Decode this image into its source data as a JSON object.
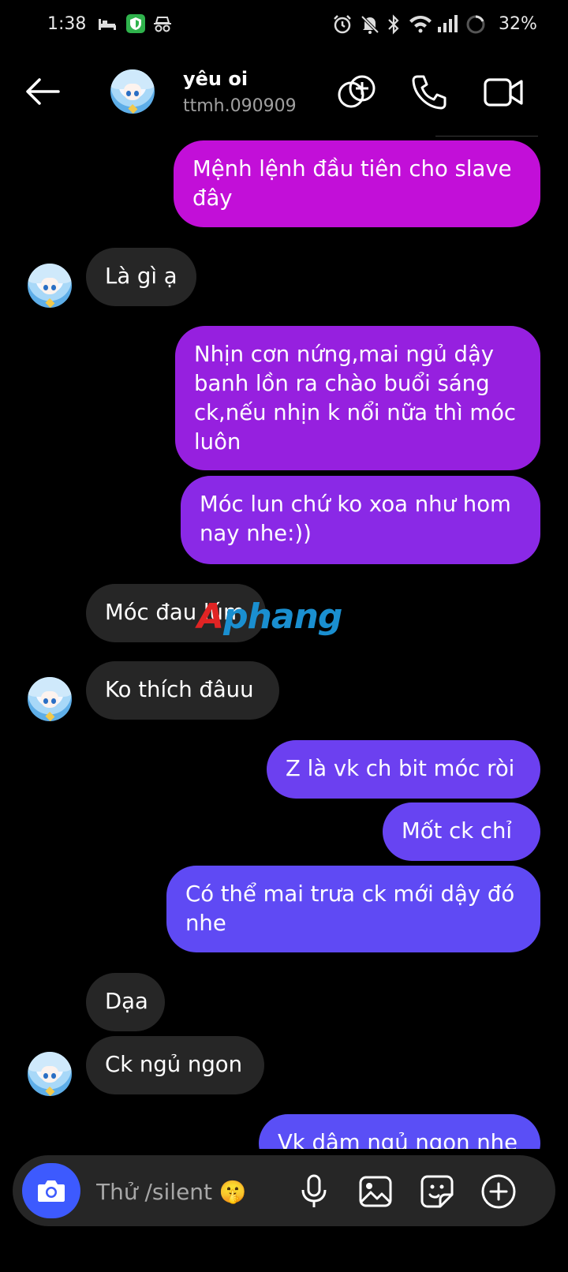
{
  "status_bar": {
    "time": "1:38",
    "battery": "32%",
    "icons": [
      "sleep-icon",
      "shield-app-icon",
      "incognito-icon",
      "alarm-icon",
      "bell-off-icon",
      "bluetooth-icon",
      "wifi-icon",
      "signal-icon",
      "battery-icon"
    ]
  },
  "header": {
    "contact_name": "yêu oi",
    "username": "ttmh.090909",
    "actions": [
      "add-effects-icon",
      "phone-icon",
      "video-camera-icon"
    ]
  },
  "messages": [
    {
      "side": "out",
      "text": "Mệnh lệnh đầu tiên cho slave đây",
      "color": "#c20fd8"
    },
    {
      "side": "in",
      "text": "Là gì ạ"
    },
    {
      "side": "out",
      "text": "Nhịn cơn nứng,mai ngủ dậy banh lồn ra chào buổi sáng ck,nếu nhịn k nổi nữa thì móc luôn",
      "color": "#9620df"
    },
    {
      "side": "out",
      "text": "Móc lun chứ ko xoa như hom nay nhe:))",
      "color": "#8a29e6"
    },
    {
      "side": "in",
      "text": "Móc đau lúm"
    },
    {
      "side": "in",
      "text": "Ko thích đâuu"
    },
    {
      "side": "out",
      "text": "Z là vk ch bit móc ròi",
      "color": "#6c40f0"
    },
    {
      "side": "out",
      "text": "Mốt ck chỉ",
      "color": "#6744f2"
    },
    {
      "side": "out",
      "text": "Có thể mai trưa ck mới dậy đó nhe",
      "color": "#5f4af4"
    },
    {
      "side": "in",
      "text": "Dạa"
    },
    {
      "side": "in",
      "text": "Ck ngủ ngon"
    },
    {
      "side": "out",
      "text": "Vk dâm ngủ ngon nhe",
      "color": "#5a4ff6"
    }
  ],
  "watermark": {
    "part1": "A",
    "part2": "phang"
  },
  "composer": {
    "placeholder": "Thử /silent 🤫",
    "buttons": [
      "camera-icon",
      "microphone-icon",
      "gallery-icon",
      "sticker-icon",
      "plus-icon"
    ],
    "camera_color": "#3d5afe"
  }
}
